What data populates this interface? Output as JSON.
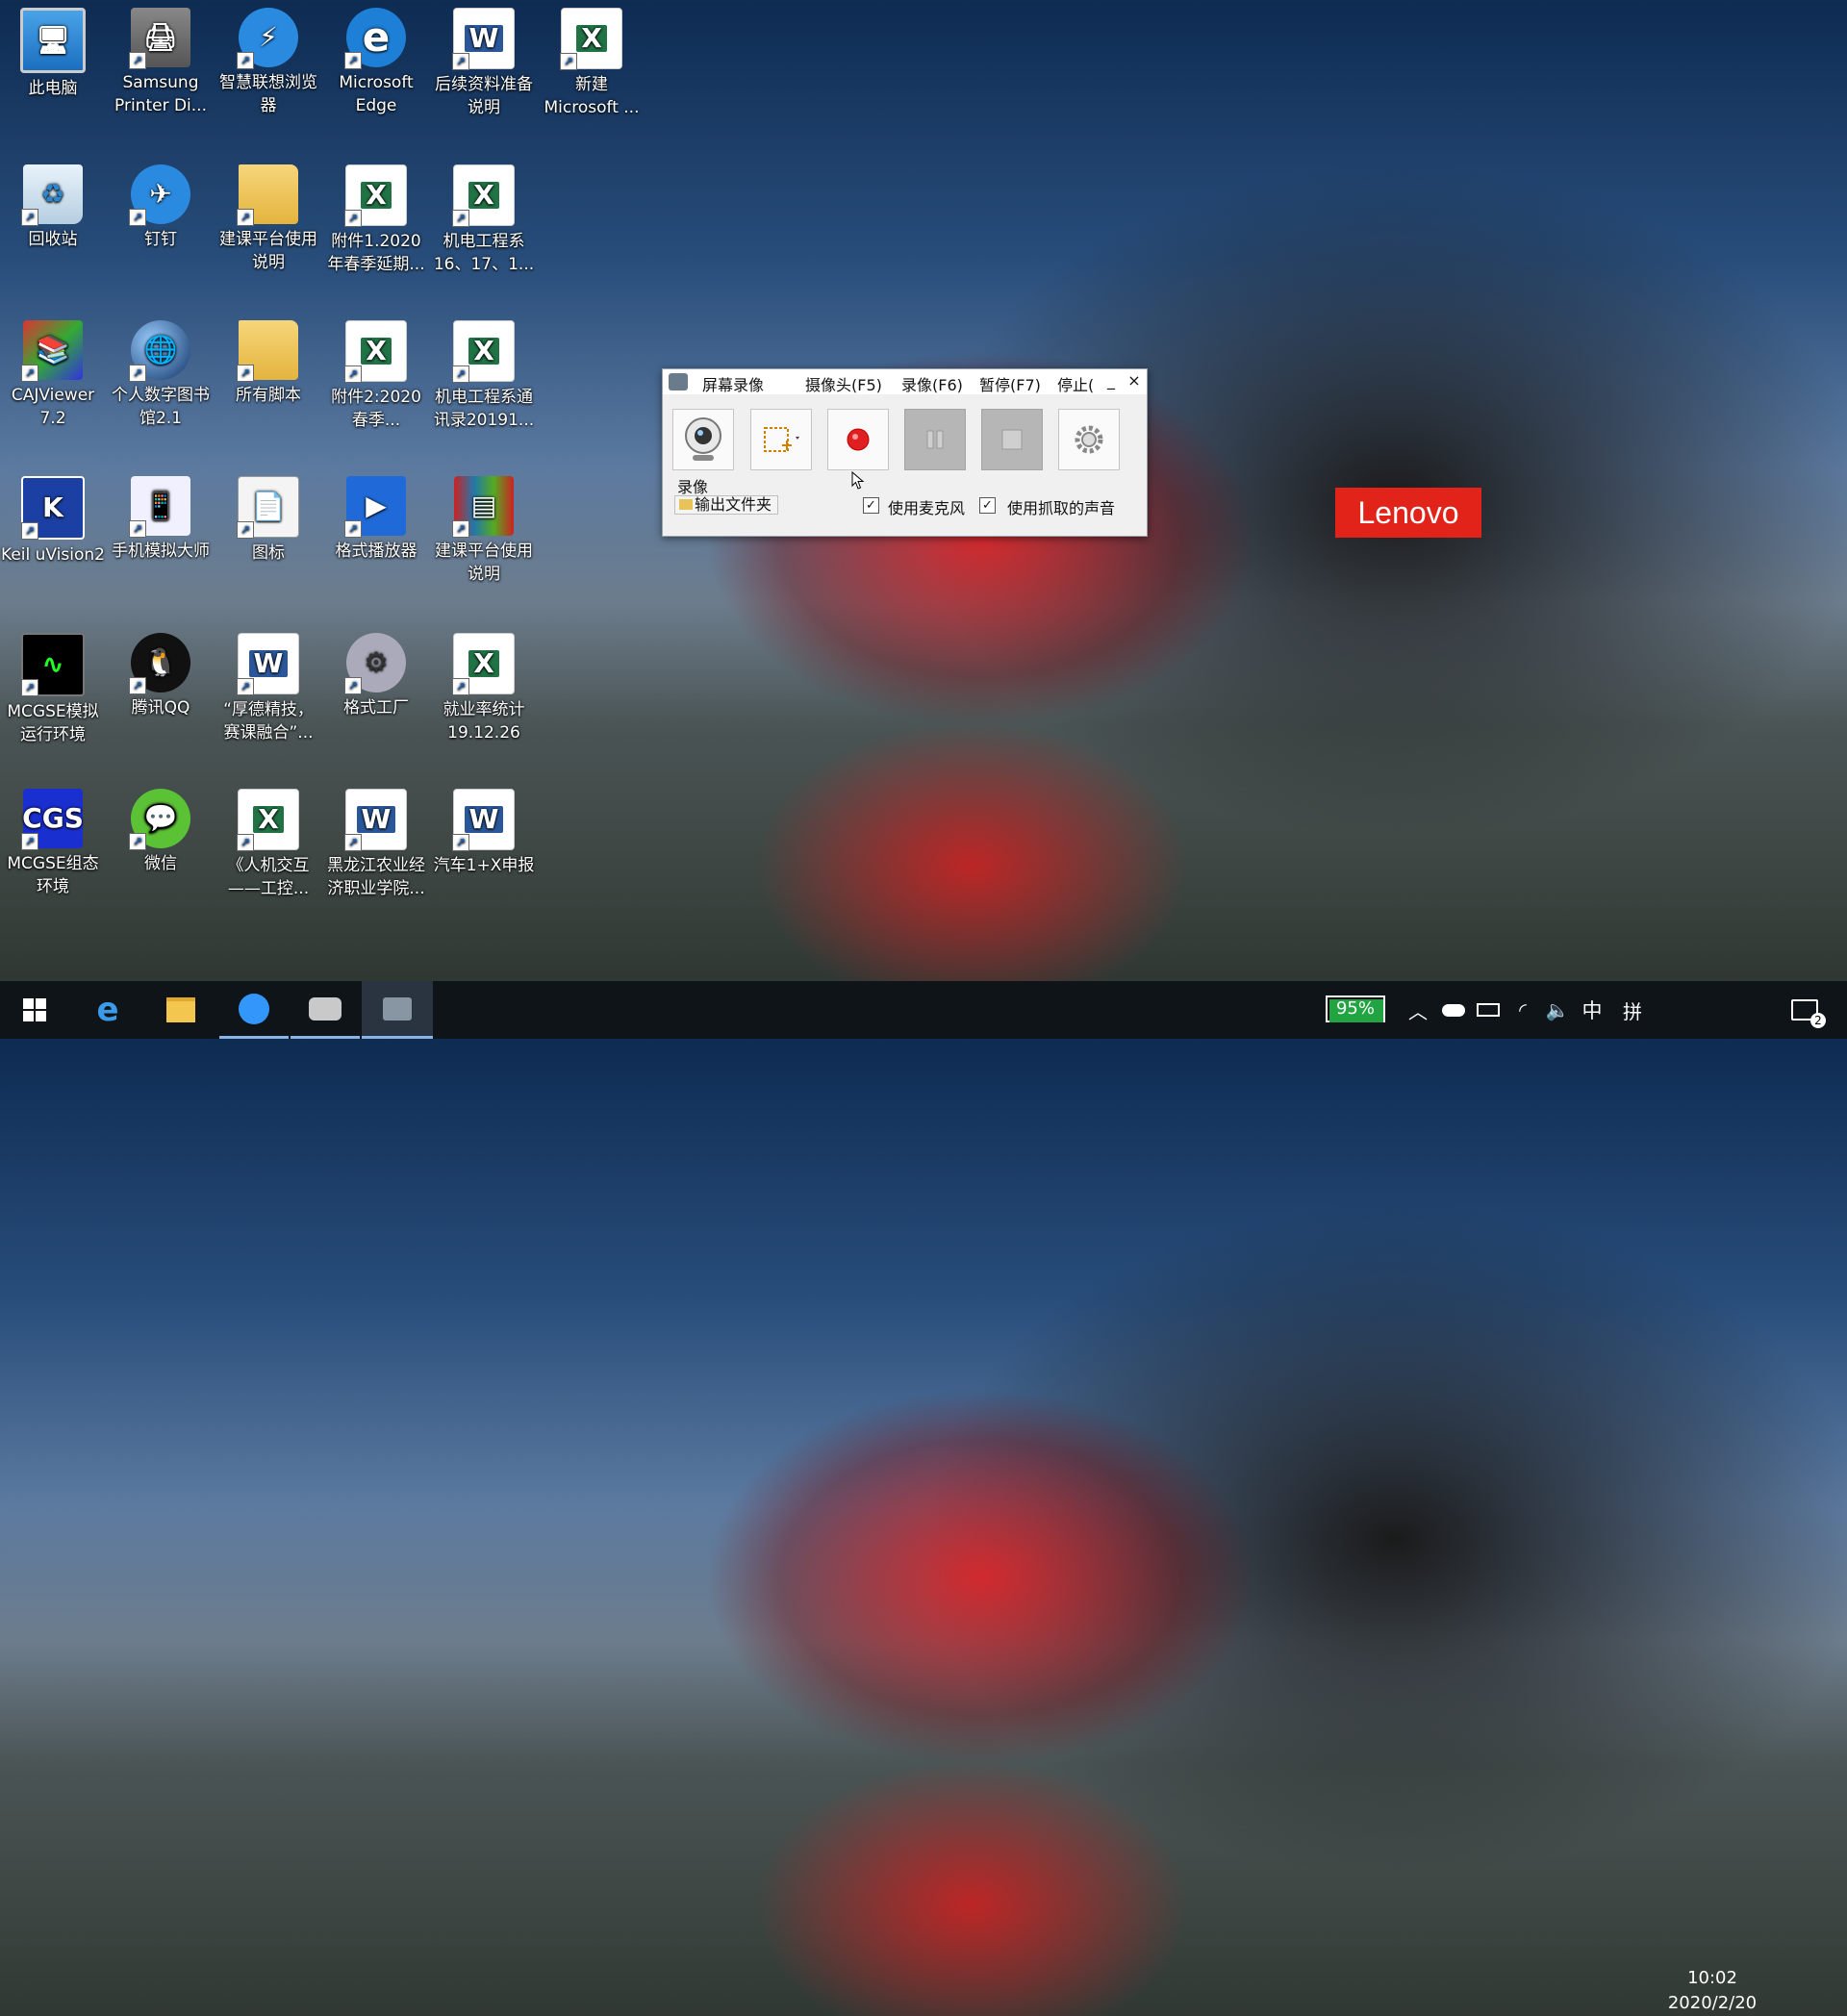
{
  "desktop_icons": [
    {
      "label": "此电脑",
      "icon": "this-pc-icon",
      "glyph": "🖥"
    },
    {
      "label": "Samsung Printer Di...",
      "icon": "printer-icon",
      "glyph": "🖨"
    },
    {
      "label": "智慧联想浏览器",
      "icon": "lenovo-browser-icon",
      "glyph": "⚡"
    },
    {
      "label": "Microsoft Edge",
      "icon": "edge-icon",
      "glyph": "e"
    },
    {
      "label": "后续资料准备说明",
      "icon": "word-doc-icon",
      "glyph": "W"
    },
    {
      "label": "新建 Microsoft ...",
      "icon": "excel-doc-icon",
      "glyph": "X"
    },
    {
      "label": "回收站",
      "icon": "recycle-bin-icon",
      "glyph": "♻"
    },
    {
      "label": "钉钉",
      "icon": "dingtalk-icon",
      "glyph": "✈"
    },
    {
      "label": "建课平台使用说明",
      "icon": "folder-icon",
      "glyph": ""
    },
    {
      "label": "附件1.2020年春季延期...",
      "icon": "excel-doc-icon",
      "glyph": "X"
    },
    {
      "label": "机电工程系16、17、1...",
      "icon": "excel-doc-icon",
      "glyph": "X"
    },
    {
      "label": "CAJViewer 7.2",
      "icon": "cajviewer-icon",
      "glyph": "📚"
    },
    {
      "label": "个人数字图书馆2.1",
      "icon": "digital-library-icon",
      "glyph": "🌐"
    },
    {
      "label": "所有脚本",
      "icon": "folder-icon",
      "glyph": ""
    },
    {
      "label": "附件2:2020春季...",
      "icon": "excel-doc-icon",
      "glyph": "X"
    },
    {
      "label": "机电工程系通讯录20191...",
      "icon": "excel-doc-icon",
      "glyph": "X"
    },
    {
      "label": "Keil uVision2",
      "icon": "keil-icon",
      "glyph": "K"
    },
    {
      "label": "手机模拟大师",
      "icon": "phone-emulator-icon",
      "glyph": "📱"
    },
    {
      "label": "图标",
      "icon": "folder-doc-icon",
      "glyph": "📄"
    },
    {
      "label": "格式播放器",
      "icon": "media-player-icon",
      "glyph": "▶"
    },
    {
      "label": "建课平台使用说明",
      "icon": "winrar-icon",
      "glyph": "▤"
    },
    {
      "label": "MCGSE模拟运行环境",
      "icon": "mcgse-sim-icon",
      "glyph": "∿"
    },
    {
      "label": "腾讯QQ",
      "icon": "qq-icon",
      "glyph": "🐧"
    },
    {
      "label": "“厚德精技，赛课融合”...",
      "icon": "word-doc-icon",
      "glyph": "W"
    },
    {
      "label": "格式工厂",
      "icon": "format-factory-icon",
      "glyph": "⚙"
    },
    {
      "label": "就业率统计19.12.26",
      "icon": "excel-doc-icon",
      "glyph": "X"
    },
    {
      "label": "MCGSE组态环境",
      "icon": "mcgse-config-icon",
      "glyph": "CGS"
    },
    {
      "label": "微信",
      "icon": "wechat-icon",
      "glyph": "💬"
    },
    {
      "label": "《人机交互——工控...",
      "icon": "excel-doc-icon",
      "glyph": "X"
    },
    {
      "label": "黑龙江农业经济职业学院...",
      "icon": "word-doc-icon",
      "glyph": "W"
    },
    {
      "label": "汽车1+X申报",
      "icon": "word-doc-icon",
      "glyph": "W"
    }
  ],
  "wallpaper_brand": "Lenovo",
  "recorder": {
    "title": "屏幕录像",
    "menu": [
      "摄像头(F5)",
      "录像(F6)",
      "暂停(F7)",
      "停止("
    ],
    "minimize": "_",
    "close": "×",
    "mode_label": "录像",
    "output_folder": "输出文件夹",
    "use_mic": "使用麦克风",
    "use_mic_checked": true,
    "use_captured_audio": "使用抓取的声音",
    "use_captured_audio_checked": true,
    "record_color": "#e02020"
  },
  "taskbar": {
    "apps": [
      "start-icon",
      "edge-icon",
      "file-explorer-icon",
      "dingtalk-icon",
      "screen-recorder-icon",
      "recorder-window-icon"
    ],
    "battery": "95%",
    "ime_lang": "中",
    "ime_mode": "拼",
    "time": "10:02",
    "date": "2020/2/20",
    "notifications": "2"
  }
}
